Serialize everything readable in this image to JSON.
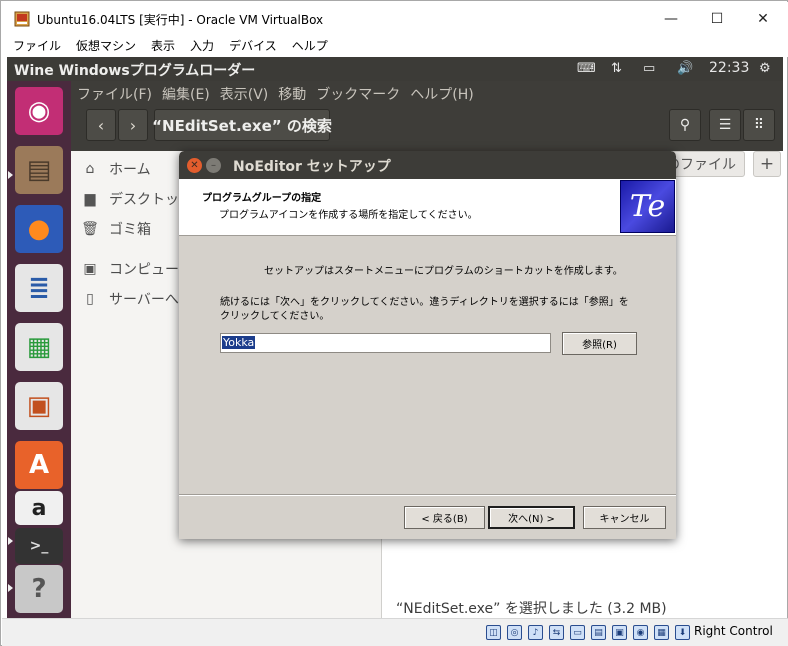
{
  "host_window": {
    "title": "Ubuntu16.04LTS [実行中] - Oracle VM VirtualBox",
    "controls": {
      "minimize": "—",
      "maximize": "☐",
      "close": "✕"
    },
    "menu": [
      "ファイル",
      "仮想マシン",
      "表示",
      "入力",
      "デバイス",
      "ヘルプ"
    ]
  },
  "guest_topbar": {
    "app_title": "Wine Windowsプログラムローダー",
    "indicators": [
      "keyboard-icon",
      "network-icon",
      "battery-icon",
      "volume-icon",
      "settings-icon"
    ],
    "clock": "22:33"
  },
  "launcher": {
    "items": [
      "ubuntu-dash",
      "files",
      "firefox",
      "libreoffice-writer",
      "libreoffice-calc",
      "libreoffice-impress",
      "software-center",
      "amazon",
      "terminal",
      "help"
    ]
  },
  "nautilus": {
    "menu": [
      "ファイル(F)",
      "編集(E)",
      "表示(V)",
      "移動",
      "ブックマーク",
      "ヘルプ(H)"
    ],
    "search_label": "“NEditSet.exe” の検索",
    "sidebar": [
      "ホーム",
      "デスクトップ",
      "ゴミ箱",
      "コンピューター",
      "サーバーへ"
    ],
    "tab_label": "のファイル",
    "status": "“NEditSet.exe” を選択しました (3.2 MB)"
  },
  "dialog": {
    "title": "NoEditor セットアップ",
    "heading": "プログラムグループの指定",
    "subheading": "プログラムアイコンを作成する場所を指定してください。",
    "logo_text": "Te",
    "intro": "セットアップはスタートメニューにプログラムのショートカットを作成します。",
    "instruction": "続けるには「次へ」をクリックしてください。違うディレクトリを選択するには「参照」をクリックしてください。",
    "folder_value": "Yokka",
    "browse": "参照(R)",
    "back": "< 戻る(B)",
    "next": "次へ(N) >",
    "cancel": "キャンセル"
  },
  "status_bar": {
    "host_key": "Right Control"
  }
}
